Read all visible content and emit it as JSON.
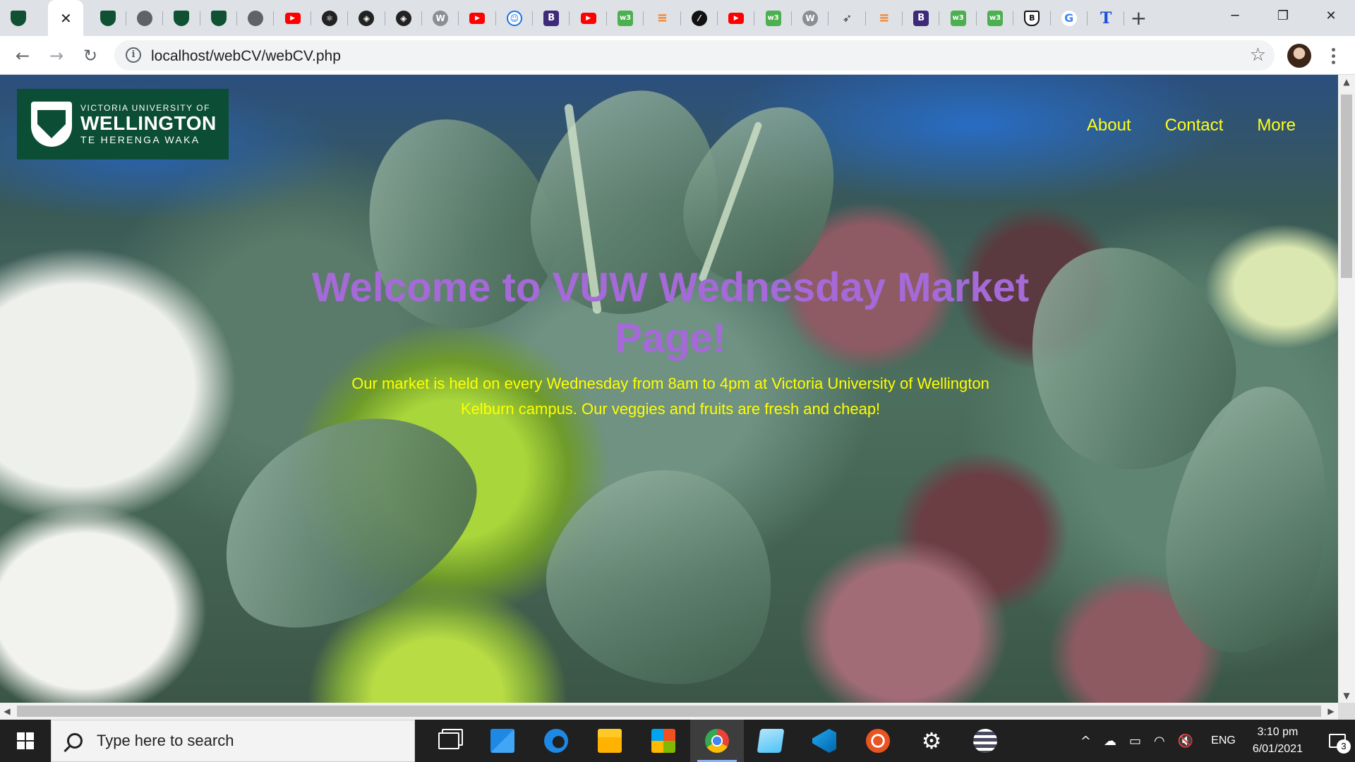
{
  "browser": {
    "tabs": [
      {
        "icon": "vuw-shield-icon",
        "glyph": "",
        "cls": "shield"
      },
      {
        "icon": "close-icon",
        "glyph": "✕",
        "cls": "active"
      },
      {
        "icon": "vuw-shield-icon",
        "glyph": "",
        "cls": "shield"
      },
      {
        "icon": "globe-icon",
        "glyph": "",
        "cls": "globe"
      },
      {
        "icon": "vuw-shield-icon",
        "glyph": "",
        "cls": "shield"
      },
      {
        "icon": "vuw-shield-icon",
        "glyph": "",
        "cls": "shield"
      },
      {
        "icon": "globe-icon",
        "glyph": "",
        "cls": "globe"
      },
      {
        "icon": "youtube-icon",
        "glyph": "▶",
        "cls": "yt"
      },
      {
        "icon": "react-icon",
        "glyph": "⚛",
        "cls": "dark"
      },
      {
        "icon": "codesandbox-icon",
        "glyph": "◈",
        "cls": "dark"
      },
      {
        "icon": "codesandbox-icon",
        "glyph": "◈",
        "cls": "dark"
      },
      {
        "icon": "wordpress-icon",
        "glyph": "W",
        "cls": "wp"
      },
      {
        "icon": "youtube-icon",
        "glyph": "▶",
        "cls": "yt"
      },
      {
        "icon": "robot-icon",
        "glyph": "☺",
        "cls": "atom"
      },
      {
        "icon": "bootstrap-icon",
        "glyph": "B",
        "cls": "b"
      },
      {
        "icon": "youtube-icon",
        "glyph": "▶",
        "cls": "yt"
      },
      {
        "icon": "w3schools-icon",
        "glyph": "w3",
        "cls": "w3"
      },
      {
        "icon": "stackoverflow-icon",
        "glyph": "≡",
        "cls": "stack"
      },
      {
        "icon": "circle-slash-icon",
        "glyph": "⁄",
        "cls": "circle-slash"
      },
      {
        "icon": "youtube-icon",
        "glyph": "▶",
        "cls": "yt"
      },
      {
        "icon": "w3schools-icon",
        "glyph": "w3",
        "cls": "w3"
      },
      {
        "icon": "wordpress-icon",
        "glyph": "W",
        "cls": "wp"
      },
      {
        "icon": "bird-icon",
        "glyph": "➶",
        "cls": "bird"
      },
      {
        "icon": "stackoverflow-icon",
        "glyph": "≡",
        "cls": "stack"
      },
      {
        "icon": "bootstrap-icon",
        "glyph": "B",
        "cls": "b"
      },
      {
        "icon": "w3schools-icon",
        "glyph": "w3",
        "cls": "w3"
      },
      {
        "icon": "w3schools-icon",
        "glyph": "w3",
        "cls": "w3"
      },
      {
        "icon": "shield-b-icon",
        "glyph": "B",
        "cls": "bs"
      },
      {
        "icon": "google-icon",
        "glyph": "G",
        "cls": "g"
      },
      {
        "icon": "t-letter-icon",
        "glyph": "T",
        "cls": "t"
      }
    ],
    "new_tab_glyph": "+",
    "window_controls": {
      "minimize": "─",
      "restore": "❐",
      "close": "✕"
    },
    "nav": {
      "back": "←",
      "forward": "→",
      "reload": "↻"
    },
    "url": "localhost/webCV/webCV.php",
    "info_glyph": "i",
    "star_glyph": "☆"
  },
  "page": {
    "logo": {
      "line1": "VICTORIA UNIVERSITY OF",
      "line2": "WELLINGTON",
      "line3": "TE HERENGA WAKA"
    },
    "nav": [
      {
        "label": "About"
      },
      {
        "label": "Contact"
      },
      {
        "label": "More"
      }
    ],
    "hero": {
      "title": "Welcome to VUW Wednesday Market Page!",
      "subtitle": "Our market is held on every Wednesday from 8am to 4pm at Victoria University of Wellington Kelburn campus. Our veggies and fruits are fresh and cheap!"
    },
    "colors": {
      "title": "#a569d8",
      "subtitle": "#ffff00",
      "nav": "#ffff1a",
      "logo_bg": "#0b4d35"
    }
  },
  "scrollbar": {
    "up": "▲",
    "down": "▼",
    "left": "◀",
    "right": "▶"
  },
  "taskbar": {
    "search_placeholder": "Type here to search",
    "apps": [
      {
        "name": "task-view-icon",
        "cls": "ic-taskview"
      },
      {
        "name": "mail-icon",
        "cls": "ic-mail"
      },
      {
        "name": "edge-icon",
        "cls": "ic-edge"
      },
      {
        "name": "file-explorer-icon",
        "cls": "ic-folder"
      },
      {
        "name": "store-icon",
        "cls": "ic-store"
      },
      {
        "name": "chrome-icon",
        "cls": "ic-chrome"
      },
      {
        "name": "notes-icon",
        "cls": "ic-notes"
      },
      {
        "name": "vscode-icon",
        "cls": "ic-vscode"
      },
      {
        "name": "ubuntu-icon",
        "cls": "ic-ubuntu"
      },
      {
        "name": "settings-gear-icon",
        "cls": "ic-gear"
      },
      {
        "name": "sublime-icon",
        "cls": "ic-sublime"
      }
    ],
    "tray": {
      "chevron": "^",
      "cloud": "☁",
      "battery": "▭",
      "wifi": "◠",
      "volume": "🔇",
      "language": "ENG",
      "time": "3:10 pm",
      "date": "6/01/2021",
      "notification_count": "3"
    }
  }
}
